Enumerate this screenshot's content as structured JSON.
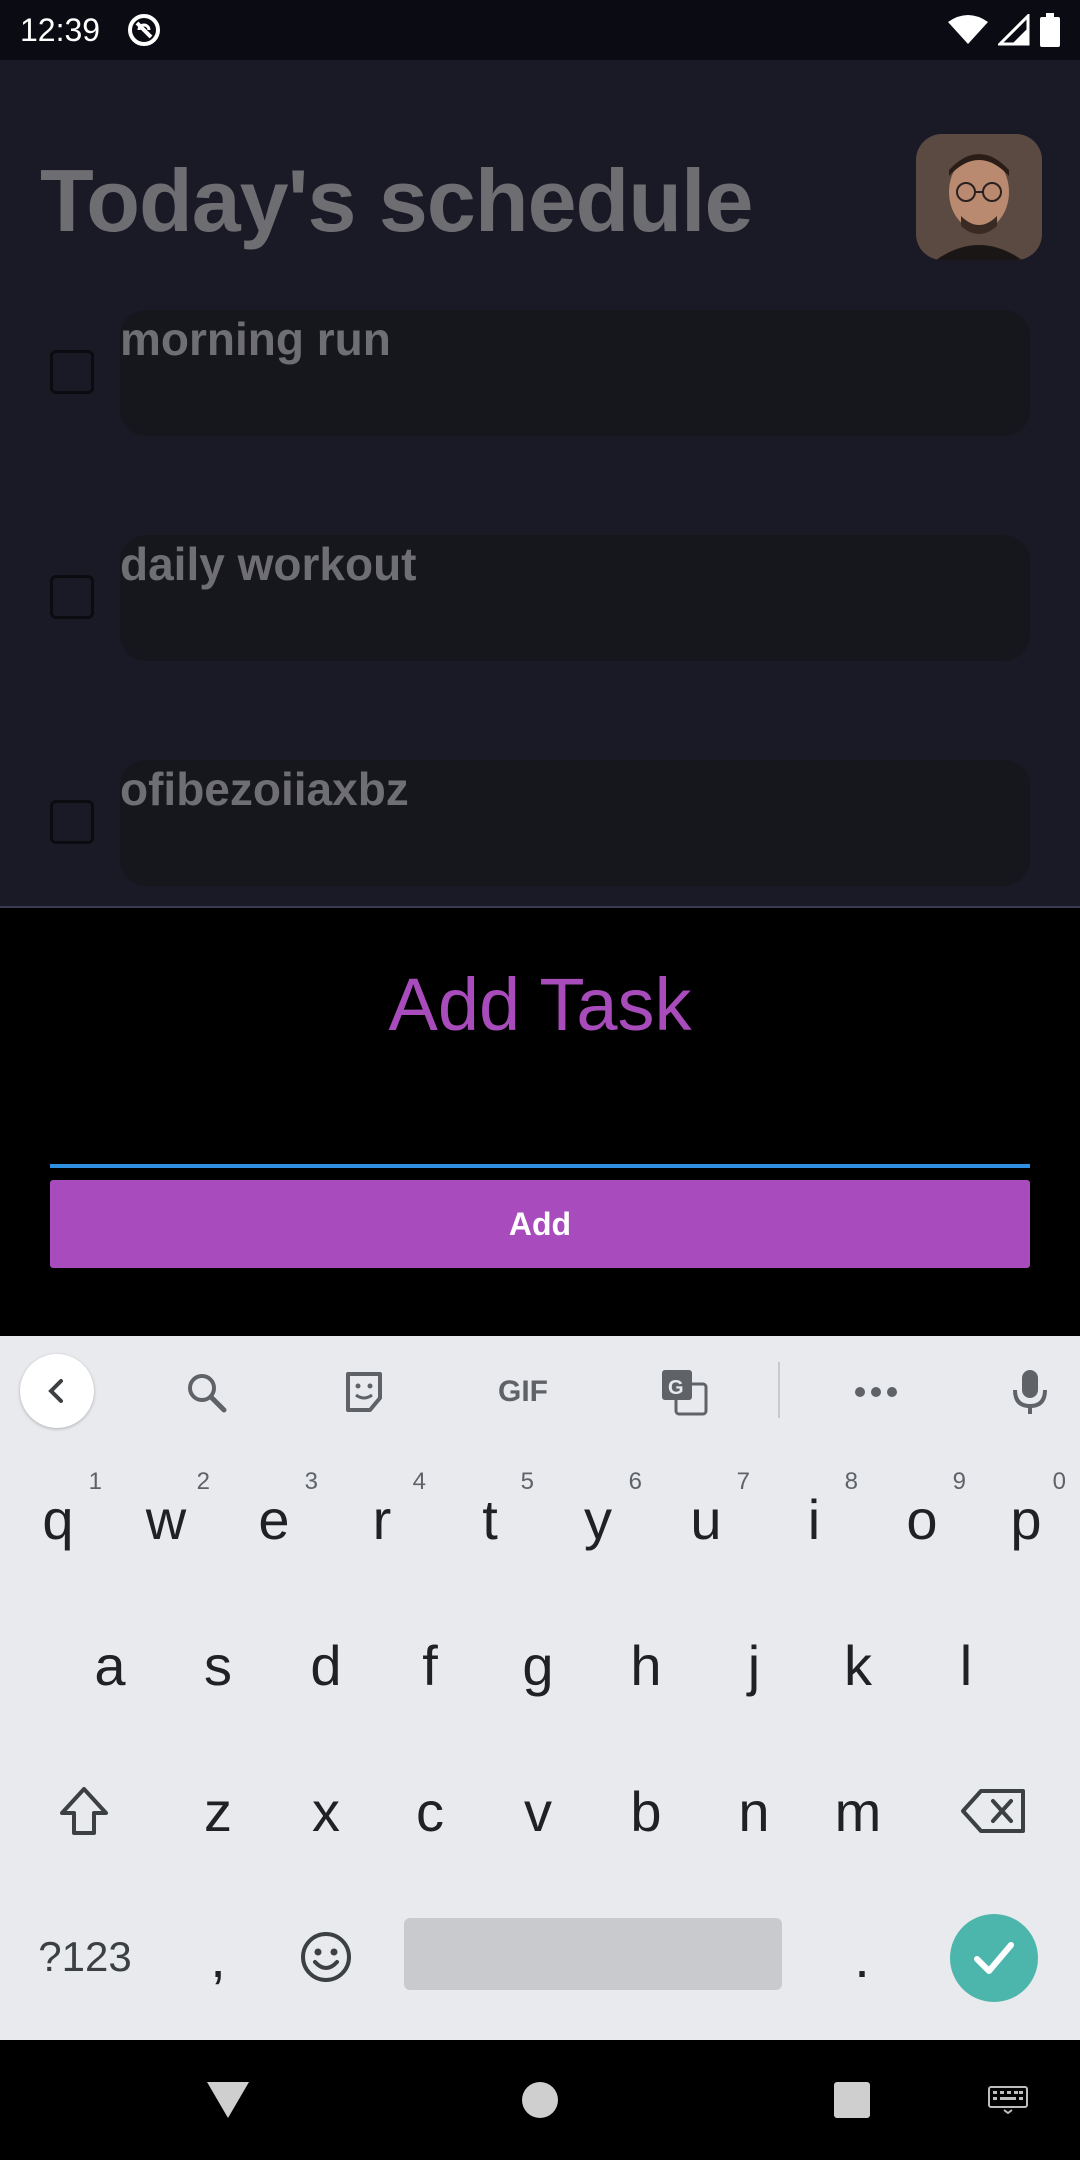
{
  "status_bar": {
    "time": "12:39",
    "icons": [
      "no-disturb-icon",
      "wifi-icon",
      "signal-icon",
      "battery-icon"
    ]
  },
  "app": {
    "title": "Today's schedule",
    "tasks": [
      {
        "label": "morning run",
        "checked": false
      },
      {
        "label": "daily workout",
        "checked": false
      },
      {
        "label": "ofibezoiiaxbz",
        "checked": false
      }
    ]
  },
  "sheet": {
    "title": "Add Task",
    "input_value": "",
    "add_label": "Add"
  },
  "keyboard": {
    "toolbar": [
      "back-icon",
      "search-icon",
      "sticker-icon",
      "GIF",
      "translate-icon",
      "more-icon",
      "mic-icon"
    ],
    "row1": [
      {
        "k": "q",
        "h": "1"
      },
      {
        "k": "w",
        "h": "2"
      },
      {
        "k": "e",
        "h": "3"
      },
      {
        "k": "r",
        "h": "4"
      },
      {
        "k": "t",
        "h": "5"
      },
      {
        "k": "y",
        "h": "6"
      },
      {
        "k": "u",
        "h": "7"
      },
      {
        "k": "i",
        "h": "8"
      },
      {
        "k": "o",
        "h": "9"
      },
      {
        "k": "p",
        "h": "0"
      }
    ],
    "row2": [
      "a",
      "s",
      "d",
      "f",
      "g",
      "h",
      "j",
      "k",
      "l"
    ],
    "row3": [
      "z",
      "x",
      "c",
      "v",
      "b",
      "n",
      "m"
    ],
    "symbols_label": "?123",
    "comma": ",",
    "period": "."
  },
  "colors": {
    "accent": "#a84bbd",
    "input_underline": "#2f8fe0",
    "enter_key": "#4db6ac"
  }
}
